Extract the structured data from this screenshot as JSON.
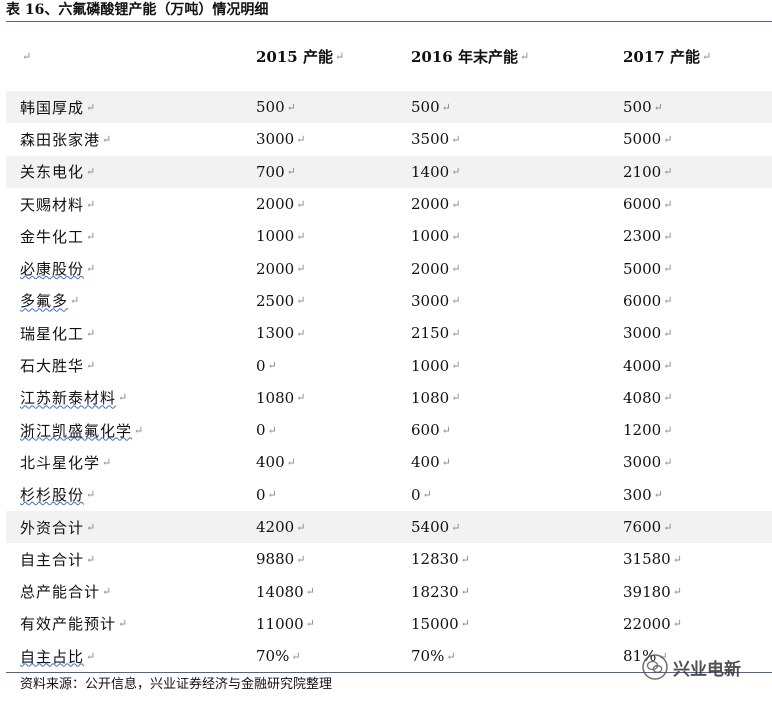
{
  "title": "表 16、六氟磷酸锂产能（万吨）情况明细",
  "columns": [
    "",
    "2015 产能",
    "2016 年末产能",
    "2017 产能"
  ],
  "rows": [
    [
      "韩国厚成",
      "500",
      "500",
      "500"
    ],
    [
      "森田张家港",
      "3000",
      "3500",
      "5000"
    ],
    [
      "关东电化",
      "700",
      "1400",
      "2100"
    ],
    [
      "天赐材料",
      "2000",
      "2000",
      "6000"
    ],
    [
      "金牛化工",
      "1000",
      "1000",
      "2300"
    ],
    [
      "必康股份",
      "2000",
      "2000",
      "5000"
    ],
    [
      "多氟多",
      "2500",
      "3000",
      "6000"
    ],
    [
      "瑞星化工",
      "1300",
      "2150",
      "3000"
    ],
    [
      "石大胜华",
      "0",
      "1000",
      "4000"
    ],
    [
      "江苏新泰材料",
      "1080",
      "1080",
      "4080"
    ],
    [
      "浙江凯盛氟化学",
      "0",
      "600",
      "1200"
    ],
    [
      "北斗星化学",
      "400",
      "400",
      "3000"
    ],
    [
      "杉杉股份",
      "0",
      "0",
      "300"
    ],
    [
      "外资合计",
      "4200",
      "5400",
      "7600"
    ],
    [
      "自主合计",
      "9880",
      "12830",
      "31580"
    ],
    [
      "总产能合计",
      "14080",
      "18230",
      "39180"
    ],
    [
      "有效产能预计",
      "11000",
      "15000",
      "22000"
    ],
    [
      "自主占比",
      "70%",
      "70%",
      "81%"
    ]
  ],
  "footer": "资料来源：公开信息，兴业证券经济与金融研究院整理",
  "watermark": "兴业电新",
  "mark_glyph": "↵",
  "colors": {
    "rule": "#4a63a8",
    "shaded_row": "#f2f2f2"
  }
}
